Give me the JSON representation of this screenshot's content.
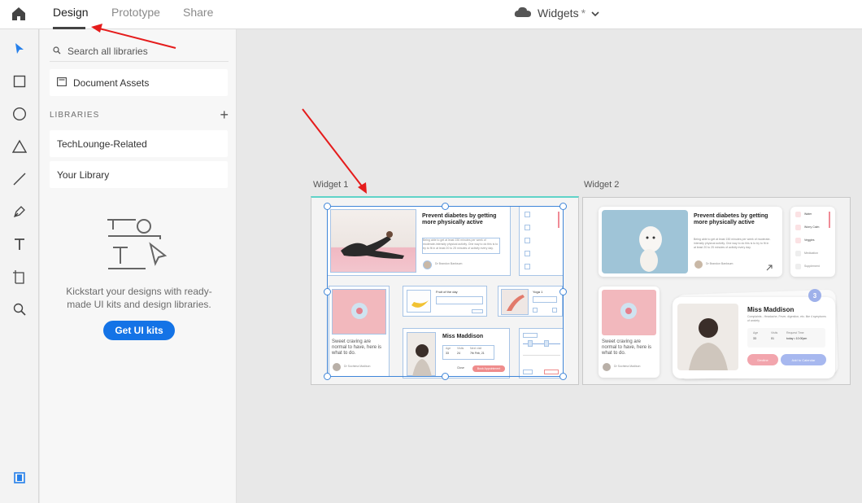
{
  "topbar": {
    "tabs": [
      {
        "label": "Design",
        "active": true
      },
      {
        "label": "Prototype",
        "active": false
      },
      {
        "label": "Share",
        "active": false
      }
    ],
    "document_title": "Widgets",
    "unsaved_mark": "*"
  },
  "tools": [
    "select-tool",
    "rectangle-tool",
    "ellipse-tool",
    "triangle-tool",
    "line-tool",
    "pen-tool",
    "text-tool",
    "artboard-tool",
    "zoom-tool"
  ],
  "panel": {
    "search_placeholder": "Search all libraries",
    "document_assets": "Document Assets",
    "libraries_heading": "LIBRARIES",
    "libraries": [
      "TechLounge-Related",
      "Your Library"
    ],
    "promo_text": "Kickstart your designs with ready-made UI kits and design libraries.",
    "cta_label": "Get UI kits"
  },
  "canvas": {
    "artboard1": {
      "label": "Widget 1",
      "article_title": "Prevent diabetes by getting more physically active",
      "article_excerpt": "Being able to get at least 150 minutes per week of moderate-intensity physical activity. One way to do this is to try to fit in at least 20 to 25 minutes of activity every day.",
      "article_author": "Dr Brandon Banksum",
      "craving_text": "Sweet craving are normal to have, here is what to do.",
      "craving_author": "Dr Sochima Madison",
      "food_title": "Fruit of the day",
      "yoga_title": "Yoga 1",
      "profile_name": "Miss Maddison",
      "profile_stats": [
        "33",
        "24",
        "7th Feb, 21"
      ],
      "profile_stat_labels": [
        "Age",
        "Visits",
        "Next visit"
      ],
      "cancel_label": "Close",
      "book_label": "Book Appointment"
    },
    "artboard2": {
      "label": "Widget 2",
      "article_title": "Prevent diabetes by getting more physically active",
      "article_excerpt": "Being able to get at least 150 minutes per week of moderate-intensity physical activity. One way to do this is to try to fit in at least 20 to 25 minutes of activity every day.",
      "article_author": "Dr Brandon Banksum",
      "checklist": [
        "Water",
        "Worry Calm",
        "Veggies",
        "Medication",
        "Supplement"
      ],
      "craving_text": "Sweet craving are normal to have, here is what to do.",
      "craving_author": "Dr Sochima Madison",
      "badge_count": "3",
      "profile_name": "Miss Maddison",
      "profile_subtitle": "Complaints - Headache, Fever, digestion, etc. like 4 symptoms of anxiety",
      "profile_stat_labels": [
        "Age",
        "Visits",
        "Request Time"
      ],
      "profile_stats": [
        "33",
        "01",
        "today • 10:00pm"
      ],
      "decline_label": "Decline",
      "add_label": "Add to Calendar"
    }
  },
  "colors": {
    "accent": "#1473e6",
    "annotation_arrow": "#e51c1c",
    "selection": "#3f86d9",
    "pink": "#f2b8bd",
    "lavender": "#a7b8ef"
  }
}
